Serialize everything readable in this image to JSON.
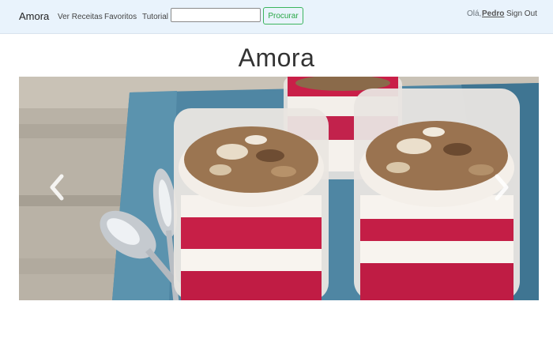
{
  "navbar": {
    "brand": "Amora",
    "links": [
      "Ver Receitas",
      "Favoritos",
      "Tutorial"
    ],
    "search": {
      "value": "",
      "placeholder": ""
    },
    "search_button": "Procurar",
    "greeting": "Olá,",
    "username": "Pedro",
    "signout": "Sign Out"
  },
  "page": {
    "title": "Amora"
  },
  "carousel": {
    "image_icon": "photo-parfait-icon",
    "prev_icon": "chevron-left-icon",
    "next_icon": "chevron-right-icon"
  },
  "colors": {
    "navbar_bg": "#e9f3fc",
    "button_green": "#28a745",
    "berry": "#c8234a"
  }
}
